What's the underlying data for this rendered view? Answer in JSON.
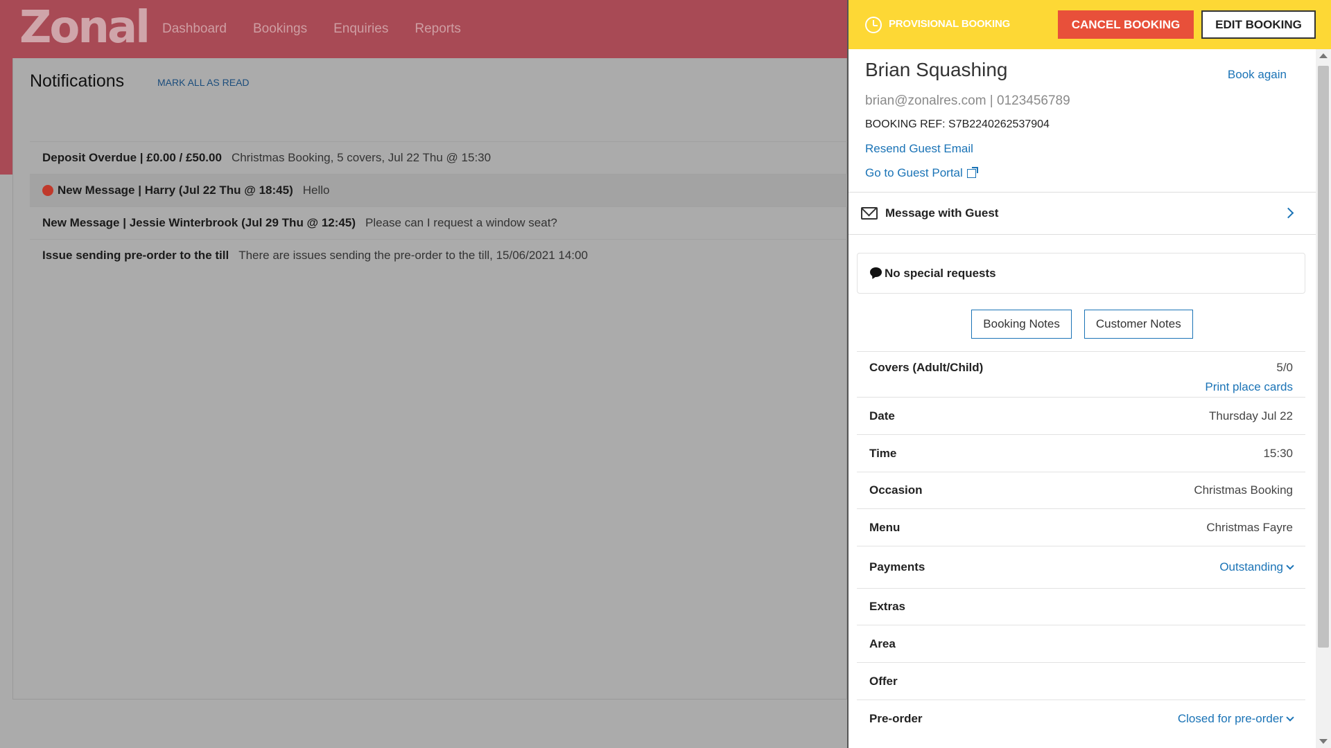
{
  "app": {
    "logo": "Zonal",
    "nav": [
      "Dashboard",
      "Bookings",
      "Enquiries",
      "Reports"
    ]
  },
  "notifications": {
    "title": "Notifications",
    "mark_all_label": "MARK ALL AS READ",
    "items": [
      {
        "title": "Deposit Overdue | £0.00 / £50.00",
        "detail": "Christmas Booking, 5 covers, Jul 22 Thu @ 15:30",
        "unread": false
      },
      {
        "title": "New Message | Harry (Jul 22 Thu @ 18:45)",
        "detail": "Hello",
        "unread": true
      },
      {
        "title": "New Message | Jessie Winterbrook (Jul 29 Thu @ 12:45)",
        "detail": "Please can I request a window seat?",
        "unread": false
      },
      {
        "title": "Issue sending pre-order to the till",
        "detail": "There are issues sending the pre-order to the till, 15/06/2021 14:00",
        "unread": false
      }
    ]
  },
  "booking": {
    "status_label": "PROVISIONAL BOOKING",
    "cancel_label": "CANCEL BOOKING",
    "edit_label": "EDIT BOOKING",
    "guest_name": "Brian Squashing",
    "book_again": "Book again",
    "contact": "brian@zonalres.com | 0123456789",
    "ref": "BOOKING REF: S7B2240262537904",
    "resend_email": "Resend Guest Email",
    "guest_portal": "Go to Guest Portal",
    "message_label": "Message with Guest",
    "special_requests": "No special requests",
    "booking_notes": "Booking Notes",
    "customer_notes": "Customer Notes",
    "covers_label": "Covers (Adult/Child)",
    "covers_value": "5/0",
    "print_place_cards": "Print place cards",
    "date_label": "Date",
    "date_value": "Thursday Jul 22",
    "time_label": "Time",
    "time_value": "15:30",
    "occasion_label": "Occasion",
    "occasion_value": "Christmas Booking",
    "menu_label": "Menu",
    "menu_value": "Christmas Fayre",
    "payments_label": "Payments",
    "payments_value": "Outstanding",
    "extras_label": "Extras",
    "area_label": "Area",
    "offer_label": "Offer",
    "preorder_label": "Pre-order",
    "preorder_value": "Closed for pre-order"
  },
  "colors": {
    "header_red": "#a84a55",
    "provisional_yellow": "#fdd835",
    "cancel_red": "#e8503a",
    "link_blue": "#1a73b6",
    "unread_dot": "#c0392b"
  }
}
